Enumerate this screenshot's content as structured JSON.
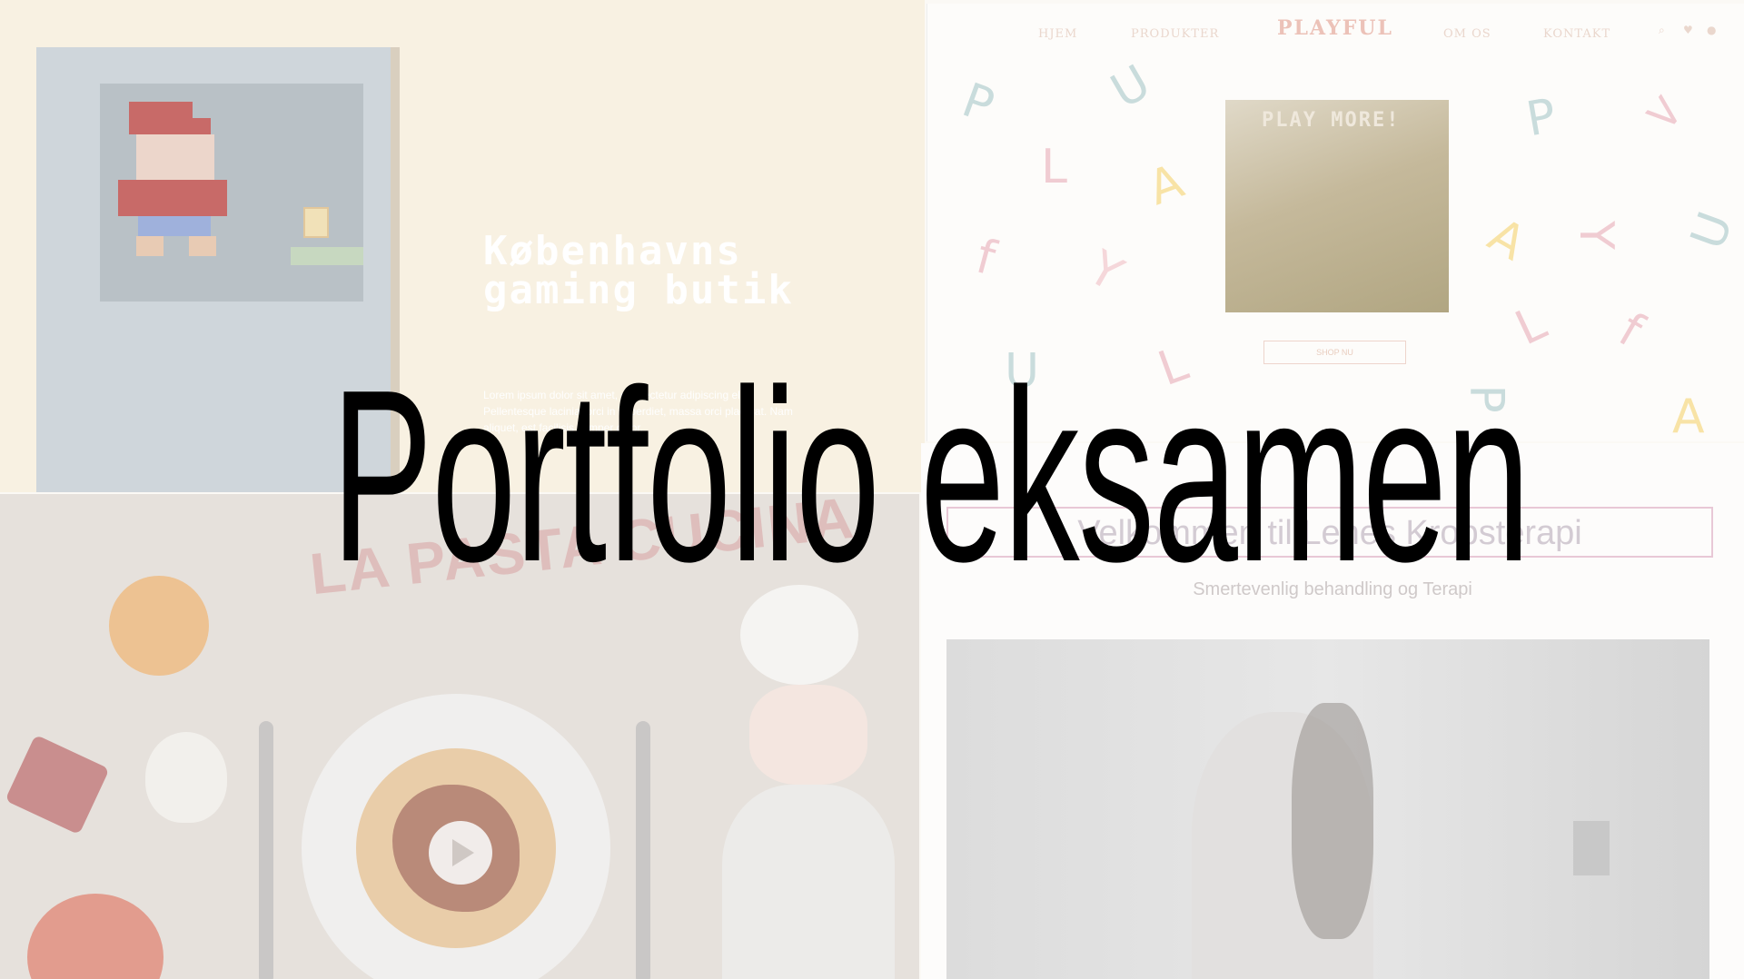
{
  "overlay": {
    "title": "Portfolio eksamen"
  },
  "gaming": {
    "title": "Københavns gaming butik",
    "lorem": "Lorem ipsum dolor sit amet, consectetur adipiscing elit. Pellentesque lacinia, orci in imperdiet, massa orci placerat. Nam aliquet, est facilisis semper dolor."
  },
  "playful": {
    "brand": "PLAYFUL",
    "nav": [
      "HJEM",
      "PRODUKTER",
      "OM OS",
      "KONTAKT"
    ],
    "hero_text": "PLAY MORE!",
    "button": "SHOP NU"
  },
  "pasta": {
    "title": "LA PASTA CUCINA"
  },
  "krop": {
    "welcome": "Velkommen til Lenes Kropsterapi",
    "sub": "Smertevenlig behandling og Terapi"
  },
  "colors": {
    "title_text": "#000000",
    "playful_accent": "#ecc2b8",
    "krop_border": "#e8c8d6"
  }
}
